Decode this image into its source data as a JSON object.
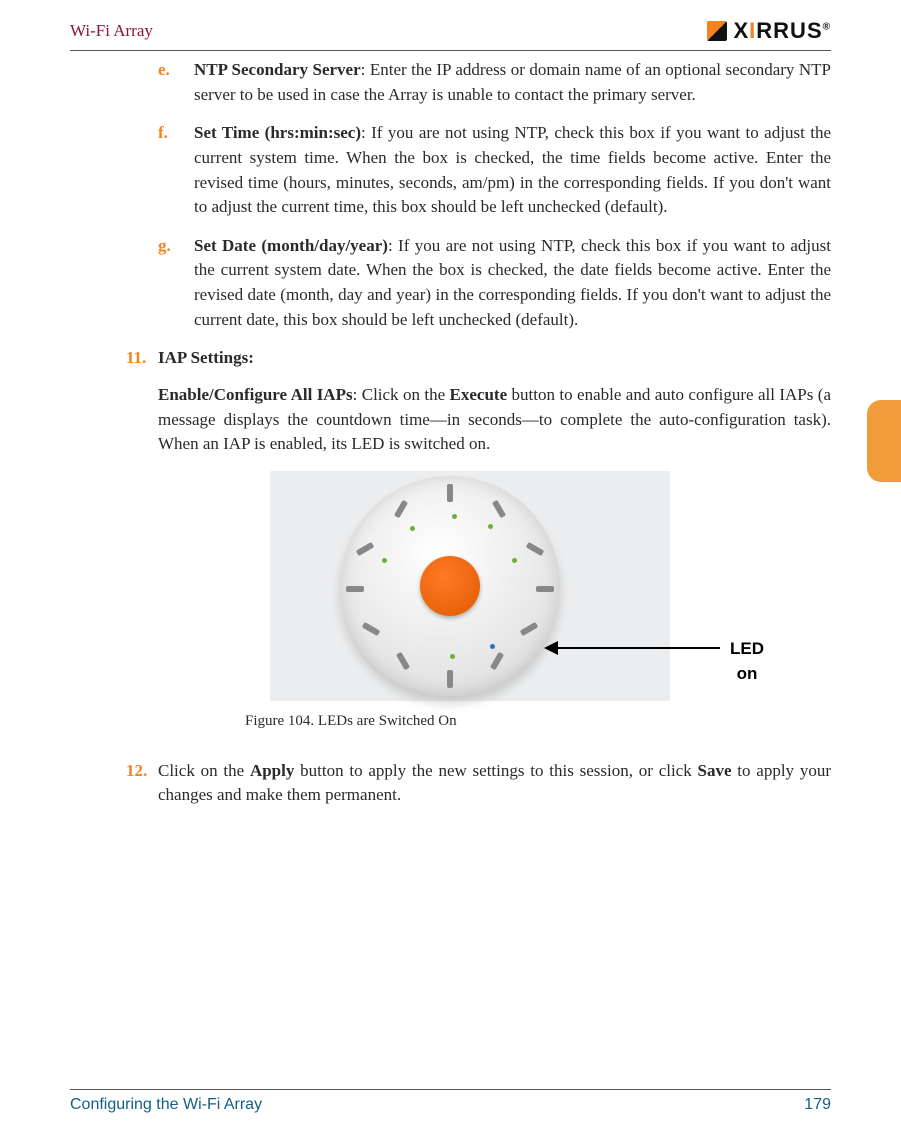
{
  "header": {
    "product_name": "Wi-Fi Array",
    "logo_text_pre": "X",
    "logo_text_accent": "I",
    "logo_text_post": "RRUS",
    "logo_reg": "®"
  },
  "item_e": {
    "marker": "e.",
    "term": "NTP Secondary Server",
    "text_after_term": ": Enter the IP address or domain name of an optional secondary NTP server to be used in case the Array is unable to contact the primary server."
  },
  "item_f": {
    "marker": "f.",
    "term": "Set Time (hrs:min:sec)",
    "text_after_term": ": If you are not using NTP, check this box if you want to adjust the current system time. When the box is checked, the time fields become active. Enter the revised time (hours, minutes, seconds, am/pm) in the corresponding fields. If you don't want to adjust the current time, this box should be left unchecked (default)."
  },
  "item_g": {
    "marker": "g.",
    "term": "Set Date (month/day/year)",
    "text_after_term": ": If you are not using NTP, check this box if you want to adjust the current system date. When the box is checked, the date fields become active. Enter the revised date (month, day and year) in the corresponding fields. If you don't want to adjust the current date, this box should be left unchecked (default)."
  },
  "item_11": {
    "marker": "11.",
    "heading": "IAP Settings:",
    "para_term": "Enable/Configure All IAPs",
    "para_pre": ": Click on the ",
    "para_btn": "Execute",
    "para_post": " button to enable and auto configure all IAPs (a message displays the countdown time—in seconds—to complete the auto-configuration task). When an IAP is enabled, its LED is switched on."
  },
  "figure": {
    "led_label": "LED on",
    "caption": "Figure 104. LEDs are Switched On"
  },
  "item_12": {
    "marker": "12.",
    "pre": "Click on the ",
    "btn1": "Apply",
    "mid": " button to apply the new settings to this session, or click ",
    "btn2": "Save",
    "post": " to apply your changes and make them permanent."
  },
  "footer": {
    "chapter": "Configuring the Wi-Fi Array",
    "page_number": "179"
  }
}
